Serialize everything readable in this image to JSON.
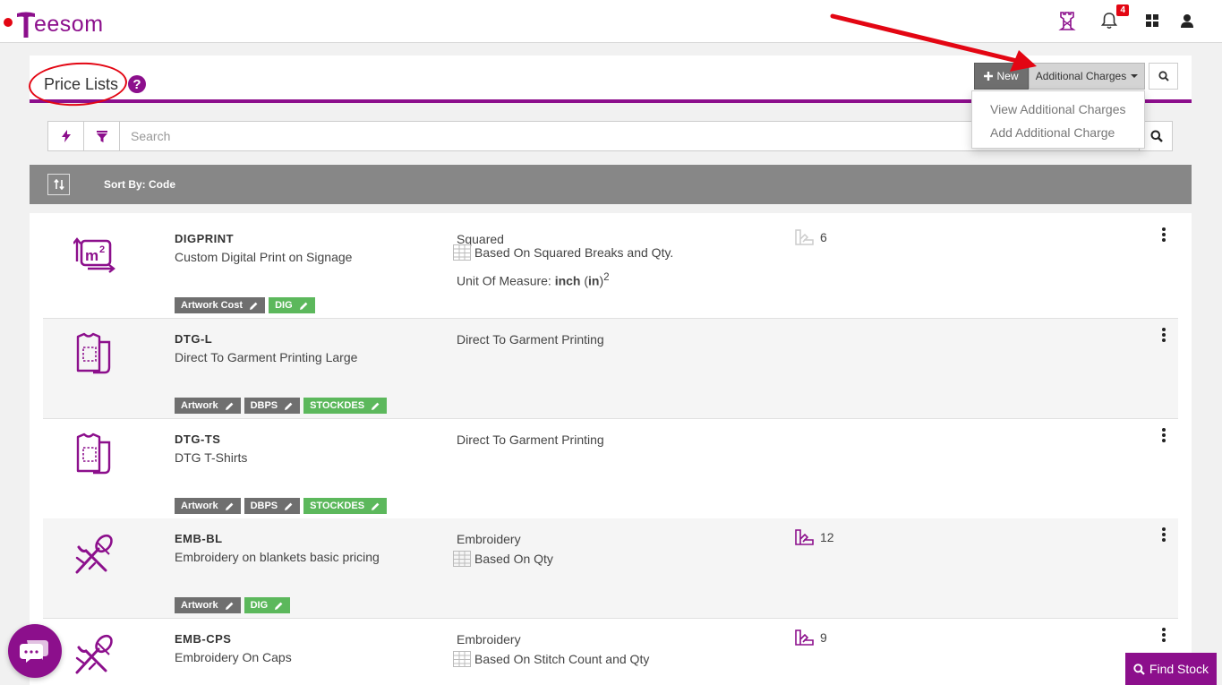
{
  "header": {
    "logo_text": "eesom",
    "logo_letter": "T",
    "notification_count": "4"
  },
  "page": {
    "title": "Price Lists",
    "help_symbol": "?"
  },
  "toolbar": {
    "new_label": "New",
    "charges_label": "Additional Charges",
    "dropdown_items": [
      "View Additional Charges",
      "Add Additional Charge"
    ]
  },
  "search": {
    "placeholder": "Search"
  },
  "sort": {
    "label": "Sort By: Code"
  },
  "rows": [
    {
      "code": "DIGPRINT",
      "description": "Custom Digital Print on Signage",
      "category": "Squared",
      "pricing": "Based On Squared Breaks and Qty.",
      "uom_prefix": "Unit Of Measure: ",
      "uom_unit": "inch",
      "uom_abbr": "in",
      "uom_power": "2",
      "count": "6",
      "tags": [
        {
          "label": "Artwork Cost",
          "color": "grey"
        },
        {
          "label": "DIG",
          "color": "green"
        }
      ]
    },
    {
      "code": "DTG-L",
      "description": "Direct To Garment Printing Large",
      "category": "Direct To Garment Printing",
      "tags": [
        {
          "label": "Artwork",
          "color": "grey"
        },
        {
          "label": "DBPS",
          "color": "grey"
        },
        {
          "label": "STOCKDES",
          "color": "green"
        }
      ]
    },
    {
      "code": "DTG-TS",
      "description": "DTG T-Shirts",
      "category": "Direct To Garment Printing",
      "tags": [
        {
          "label": "Artwork",
          "color": "grey"
        },
        {
          "label": "DBPS",
          "color": "grey"
        },
        {
          "label": "STOCKDES",
          "color": "green"
        }
      ]
    },
    {
      "code": "EMB-BL",
      "description": "Embroidery on blankets basic pricing",
      "category": "Embroidery",
      "pricing": "Based On Qty",
      "count": "12",
      "tags": [
        {
          "label": "Artwork",
          "color": "grey"
        },
        {
          "label": "DIG",
          "color": "green"
        }
      ]
    },
    {
      "code": "EMB-CPS",
      "description": "Embroidery On Caps",
      "category": "Embroidery",
      "pricing": "Based On Stitch Count and Qty",
      "count": "9"
    }
  ],
  "find_stock_label": "Find Stock",
  "colors": {
    "brand": "#8c0f8c",
    "annotation": "#e30613",
    "tag_grey": "#6f6f6f",
    "tag_green": "#5cb85c"
  },
  "icons": [
    "tower-icon",
    "bell-icon",
    "grid-icon",
    "user-icon",
    "help-icon",
    "plus-icon",
    "search-icon",
    "lightning-icon",
    "filter-icon",
    "sort-icon",
    "square-meter-icon",
    "tshirt-print-icon",
    "embroidery-needle-icon",
    "table-icon",
    "swatch-icon",
    "kebab-menu-icon",
    "pencil-icon",
    "chat-icon"
  ]
}
